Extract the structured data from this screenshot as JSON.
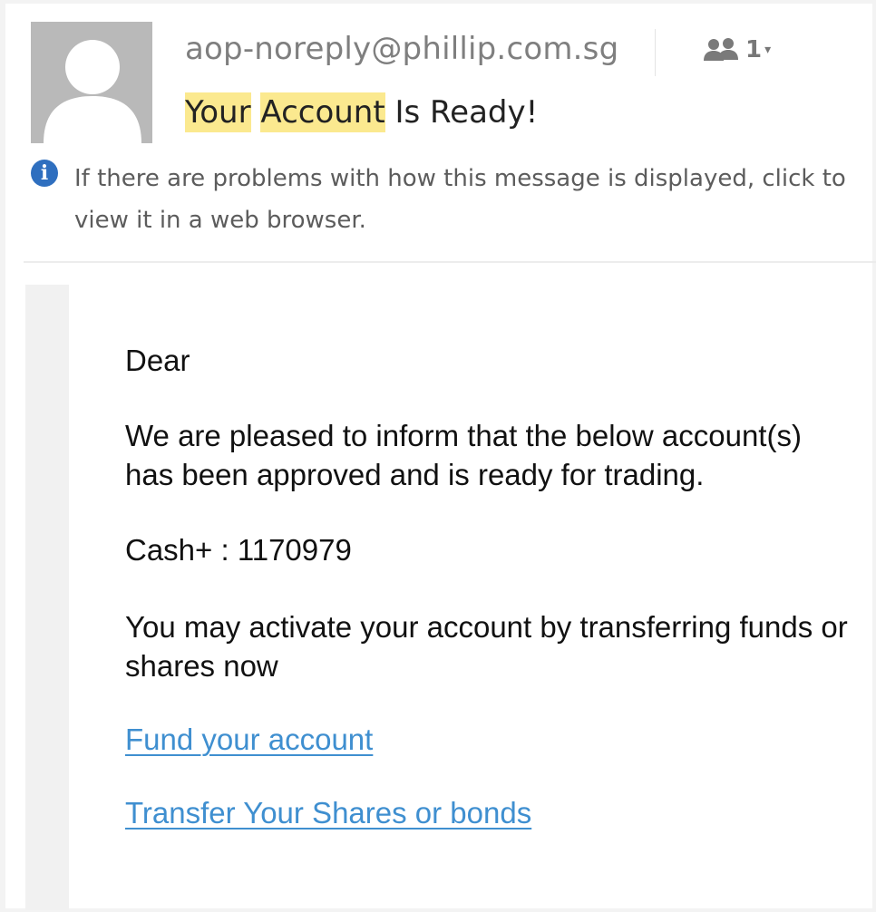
{
  "header": {
    "sender": "aop-noreply@phillip.com.sg",
    "recipients_count": "1",
    "subject_word_1": "Your",
    "subject_word_2": "Account",
    "subject_rest": "Is Ready!"
  },
  "info_bar": {
    "text": "If there are problems with how this message is displayed, click to view it in a web browser."
  },
  "message": {
    "greeting": "Dear",
    "paragraph_1": "We are pleased to inform that the below account(s) has been approved and is ready for trading.",
    "account_label": "Cash+",
    "account_number": ": 1170979",
    "paragraph_2": "You may activate your account by transferring funds or shares now",
    "link_fund": "Fund your account",
    "link_transfer": "Transfer Your Shares or bonds"
  },
  "colors": {
    "highlight_subject": "#fbe98f",
    "highlight_account": "#faf430",
    "link": "#3f8fd0",
    "info_icon": "#2f6fbf"
  },
  "icons": {
    "avatar": "person-silhouette-icon",
    "people": "people-icon",
    "info": "info-icon"
  }
}
